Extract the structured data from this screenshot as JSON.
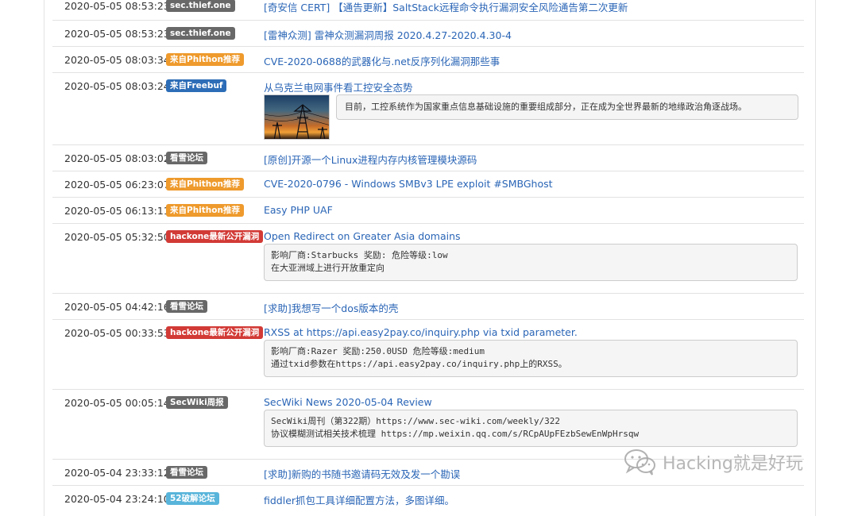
{
  "rows": [
    {
      "time": "2020-05-05 08:53:23",
      "source": "sec.thief.one",
      "color": "gray",
      "title": "[奇安信 CERT] 【通告更新】SaltStack远程命令执行漏洞安全风险通告第二次更新"
    },
    {
      "time": "2020-05-05 08:53:23",
      "source": "sec.thief.one",
      "color": "gray",
      "title": "[雷神众测] 雷神众测漏洞周报 2020.4.27-2020.4.30-4"
    },
    {
      "time": "2020-05-05 08:03:34",
      "source": "来自Phithon推荐",
      "color": "orange",
      "title": "CVE-2020-0688的武器化与.net反序列化漏洞那些事"
    },
    {
      "time": "2020-05-05 08:03:24",
      "source": "来自Freebuf",
      "color": "blue",
      "title": "从乌克兰电网事件看工控安全态势",
      "summary": "目前，工控系统作为国家重点信息基础设施的重要组成部分，正在成为全世界最新的地缘政治角逐战场。"
    },
    {
      "time": "2020-05-05 08:03:02",
      "source": "看雪论坛",
      "color": "gray",
      "title": "[原创]开源一个Linux进程内存内核管理模块源码"
    },
    {
      "time": "2020-05-05 06:23:07",
      "source": "来自Phithon推荐",
      "color": "orange",
      "title": "CVE-2020-0796 - Windows SMBv3 LPE exploit #SMBGhost"
    },
    {
      "time": "2020-05-05 06:13:11",
      "source": "来自Phithon推荐",
      "color": "orange",
      "title": "Easy PHP UAF"
    },
    {
      "time": "2020-05-05 05:32:50",
      "source": "hackone最新公开漏洞",
      "color": "red",
      "title": "Open Redirect on Greater Asia domains",
      "detail": [
        "影响厂商:Starbucks 奖励: 危险等级:low",
        "在大亚洲域上进行开放重定向"
      ]
    },
    {
      "time": "2020-05-05 04:42:16",
      "source": "看雪论坛",
      "color": "gray",
      "title": "[求助]我想写一个dos版本的壳"
    },
    {
      "time": "2020-05-05 00:33:53",
      "source": "hackone最新公开漏洞",
      "color": "red",
      "title": "RXSS at https://api.easy2pay.co/inquiry.php via txid parameter.",
      "detail": [
        "影响厂商:Razer 奖励:250.0USD 危险等级:medium",
        "通过txid参数在https://api.easy2pay.co/inquiry.php上的RXSS。"
      ]
    },
    {
      "time": "2020-05-05 00:05:14",
      "source": "SecWiki周报",
      "color": "gray",
      "title": "SecWiki News 2020-05-04 Review",
      "detail": [
        "SecWiki周刊（第322期）https://www.sec-wiki.com/weekly/322",
        "协议模糊测试相关技术梳理 https://mp.weixin.qq.com/s/RCpAUpFEzbSewEnWpHrsqw"
      ]
    },
    {
      "time": "2020-05-04 23:33:12",
      "source": "看雪论坛",
      "color": "gray",
      "title": "[求助]新购的书随书邀请码无效及发一个勘误"
    },
    {
      "time": "2020-05-04 23:24:10",
      "source": "52破解论坛",
      "color": "cyan",
      "title": "fiddler抓包工具详细配置方法，多图详细。"
    }
  ],
  "watermark": {
    "text": "Hacking就是好玩",
    "icon": "wechat-icon"
  }
}
